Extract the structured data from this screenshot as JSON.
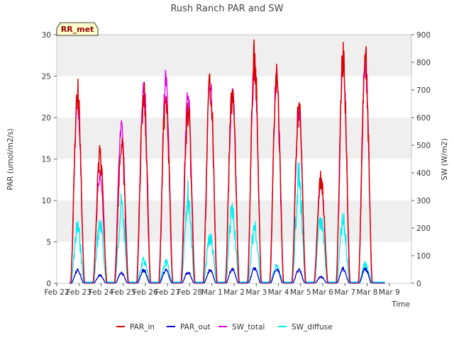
{
  "chart_data": {
    "type": "line",
    "title": "Rush Ranch PAR and SW",
    "badge": "RR_met",
    "xlabel": "Time",
    "ylabel_left": "PAR (umol/m2/s)",
    "ylabel_right": "SW (W/m2)",
    "ylim_left": [
      0,
      30
    ],
    "ylim_right": [
      0,
      900
    ],
    "yticks_left": [
      "0",
      "5",
      "10",
      "15",
      "20",
      "25",
      "30"
    ],
    "yticks_right": [
      "0",
      "100",
      "200",
      "300",
      "400",
      "500",
      "600",
      "700",
      "800",
      "900"
    ],
    "xlim_days": [
      0,
      16
    ],
    "xticks": [
      "Feb 22",
      "Feb 23",
      "Feb 24",
      "Feb 25",
      "Feb 26",
      "Feb 27",
      "Feb 28",
      "Mar 1",
      "Mar 2",
      "Mar 3",
      "Mar 4",
      "Mar 5",
      "Mar 6",
      "Mar 7",
      "Mar 8",
      "Mar 9"
    ],
    "grid": "horizontal bands",
    "legend_position": "bottom",
    "days": [
      {
        "center": 0.94,
        "par_in": 25.3,
        "par_out": 1.8,
        "sw_total": 23.0,
        "sw_diffuse": 8.0
      },
      {
        "center": 1.95,
        "par_in": 16.8,
        "par_out": 1.1,
        "sw_total": 14.0,
        "sw_diffuse": 8.5
      },
      {
        "center": 2.92,
        "par_in": 18.3,
        "par_out": 1.4,
        "sw_total": 19.8,
        "sw_diffuse": 11.0
      },
      {
        "center": 3.92,
        "par_in": 25.0,
        "par_out": 1.8,
        "sw_total": 25.6,
        "sw_diffuse": 3.2
      },
      {
        "center": 4.92,
        "par_in": 25.3,
        "par_out": 1.8,
        "sw_total": 25.9,
        "sw_diffuse": 3.0
      },
      {
        "center": 5.92,
        "par_in": 22.5,
        "par_out": 1.5,
        "sw_total": 24.0,
        "sw_diffuse": 12.8
      },
      {
        "center": 6.92,
        "par_in": 26.8,
        "par_out": 1.8,
        "sw_total": 26.0,
        "sw_diffuse": 6.8
      },
      {
        "center": 7.92,
        "par_in": 25.3,
        "par_out": 1.9,
        "sw_total": 24.0,
        "sw_diffuse": 10.5
      },
      {
        "center": 8.92,
        "par_in": 29.7,
        "par_out": 2.0,
        "sw_total": 28.0,
        "sw_diffuse": 8.0
      },
      {
        "center": 9.92,
        "par_in": 27.1,
        "par_out": 2.0,
        "sw_total": 26.5,
        "sw_diffuse": 2.4
      },
      {
        "center": 10.92,
        "par_in": 23.5,
        "par_out": 1.8,
        "sw_total": 22.0,
        "sw_diffuse": 15.0
      },
      {
        "center": 11.92,
        "par_in": 13.9,
        "par_out": 0.9,
        "sw_total": 13.0,
        "sw_diffuse": 9.5
      },
      {
        "center": 12.92,
        "par_in": 29.4,
        "par_out": 2.0,
        "sw_total": 28.5,
        "sw_diffuse": 8.7
      },
      {
        "center": 13.92,
        "par_in": 29.4,
        "par_out": 2.0,
        "sw_total": 27.5,
        "sw_diffuse": 2.7
      }
    ],
    "series": [
      {
        "name": "PAR_in",
        "color": "#dd0000"
      },
      {
        "name": "PAR_out",
        "color": "#0000cc"
      },
      {
        "name": "SW_total",
        "color": "#dd00dd"
      },
      {
        "name": "SW_diffuse",
        "color": "#00eeee"
      }
    ]
  }
}
